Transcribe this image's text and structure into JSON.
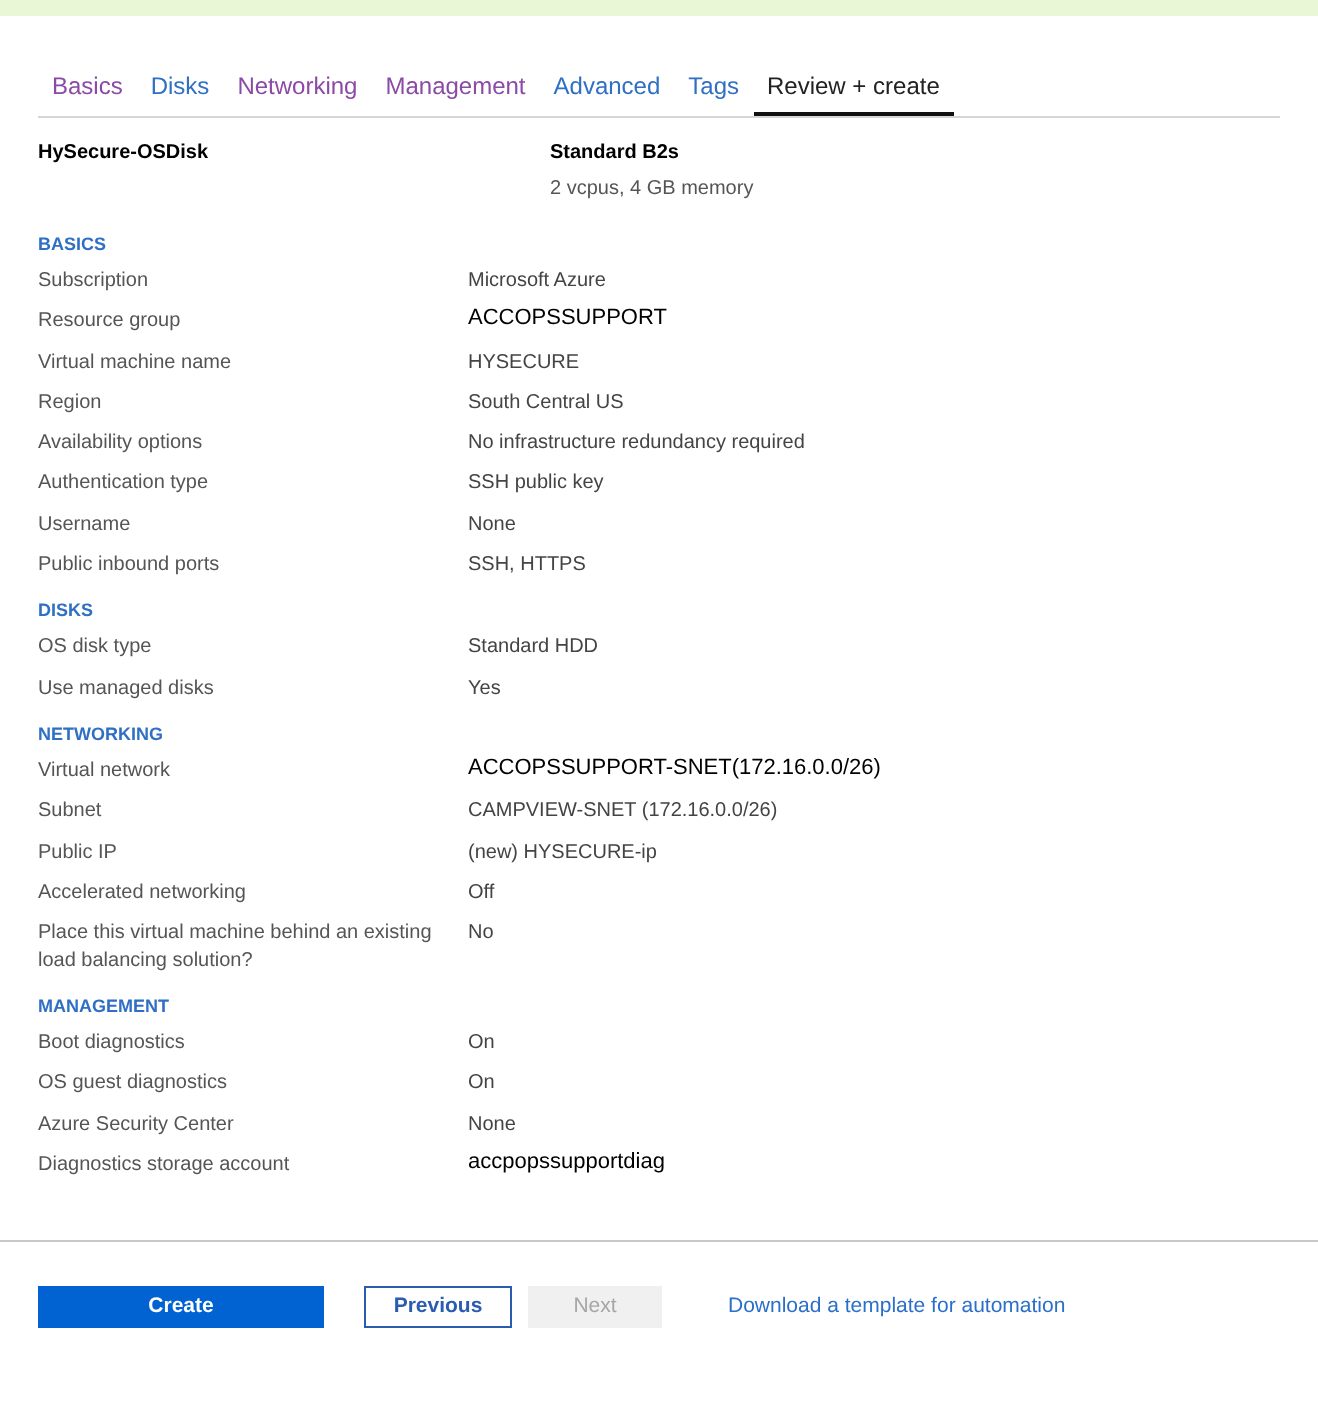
{
  "tabs": [
    {
      "label": "Basics",
      "selected": false,
      "visited": true
    },
    {
      "label": "Disks",
      "selected": false,
      "visited": false
    },
    {
      "label": "Networking",
      "selected": false,
      "visited": true
    },
    {
      "label": "Management",
      "selected": false,
      "visited": true
    },
    {
      "label": "Advanced",
      "selected": false,
      "visited": false
    },
    {
      "label": "Tags",
      "selected": false,
      "visited": false
    },
    {
      "label": "Review + create",
      "selected": true,
      "visited": false
    }
  ],
  "summary": {
    "title": "HySecure-OSDisk",
    "size": "Standard B2s",
    "size_detail": "2 vcpus, 4 GB memory"
  },
  "sections": [
    {
      "heading": "BASICS",
      "rows": [
        {
          "label": "Subscription",
          "value": "Microsoft Azure",
          "dark": false
        },
        {
          "label": "Resource group",
          "value": "ACCOPSSUPPORT",
          "dark": true
        },
        {
          "label": "Virtual machine name",
          "value": "HYSECURE",
          "dark": false
        },
        {
          "label": "Region",
          "value": "South Central US",
          "dark": false
        },
        {
          "label": "Availability options",
          "value": "No infrastructure redundancy required",
          "dark": false
        },
        {
          "label": "Authentication type",
          "value": "SSH public key",
          "dark": false
        },
        {
          "label": "Username",
          "value": "None",
          "dark": false
        },
        {
          "label": "Public inbound ports",
          "value": "SSH, HTTPS",
          "dark": false
        }
      ]
    },
    {
      "heading": "DISKS",
      "rows": [
        {
          "label": "OS disk type",
          "value": "Standard HDD",
          "dark": false
        },
        {
          "label": "Use managed disks",
          "value": "Yes",
          "dark": false
        }
      ]
    },
    {
      "heading": "NETWORKING",
      "rows": [
        {
          "label": "Virtual network",
          "value": "ACCOPSSUPPORT-SNET(172.16.0.0/26)",
          "dark": true
        },
        {
          "label": "Subnet",
          "value": "CAMPVIEW-SNET (172.16.0.0/26)",
          "dark": false
        },
        {
          "label": "Public IP",
          "value": "(new) HYSECURE-ip",
          "dark": false
        },
        {
          "label": "Accelerated networking",
          "value": "Off",
          "dark": false
        },
        {
          "label": "Place this virtual machine behind an existing load balancing solution?",
          "value": "No",
          "dark": false
        }
      ]
    },
    {
      "heading": "MANAGEMENT",
      "rows": [
        {
          "label": "Boot diagnostics",
          "value": "On",
          "dark": false
        },
        {
          "label": "OS guest diagnostics",
          "value": "On",
          "dark": false
        },
        {
          "label": "Azure Security Center",
          "value": "None",
          "dark": false
        },
        {
          "label": "Diagnostics storage account",
          "value": "accpopssupportdiag",
          "dark": true
        }
      ]
    }
  ],
  "footer": {
    "create": "Create",
    "previous": "Previous",
    "next": {
      "label": "Next",
      "disabled": true
    },
    "link": "Download a template for automation"
  }
}
